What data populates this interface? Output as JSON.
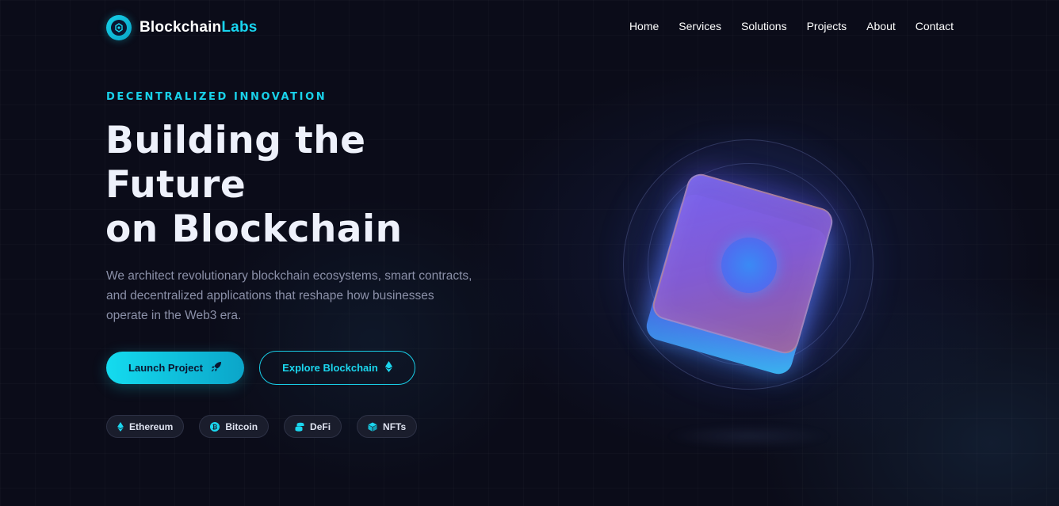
{
  "brand": {
    "name_part1": "Blockchain",
    "name_part2": "Labs",
    "accent_color": "#18d4ee"
  },
  "nav": {
    "links": [
      "Home",
      "Services",
      "Solutions",
      "Projects",
      "About",
      "Contact"
    ]
  },
  "hero": {
    "eyebrow": "DECENTRALIZED INNOVATION",
    "title_lines": [
      "Building the",
      "Future",
      "on Blockchain"
    ],
    "description": "We architect revolutionary blockchain ecosystems, smart contracts, and decentralized applications that reshape how businesses operate in the Web3 era.",
    "primary_button": {
      "label": "Launch Project",
      "icon": "rocket-icon"
    },
    "secondary_button": {
      "label": "Explore Blockchain",
      "icon": "ethereum-icon"
    },
    "tags": [
      {
        "label": "Ethereum",
        "icon": "ethereum-icon"
      },
      {
        "label": "Bitcoin",
        "icon": "bitcoin-icon"
      },
      {
        "label": "DeFi",
        "icon": "coins-icon"
      },
      {
        "label": "NFTs",
        "icon": "cube-icon"
      }
    ]
  }
}
